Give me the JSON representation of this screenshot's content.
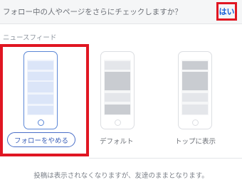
{
  "prompt": {
    "question": "フォロー中の人やページをさらにチェックしますか？",
    "yes_label": "はい"
  },
  "section_label": "ニュースフィード",
  "options": [
    {
      "id": "unfollow",
      "label": "フォローをやめる",
      "selected": true
    },
    {
      "id": "default",
      "label": "デフォルト",
      "selected": false
    },
    {
      "id": "top",
      "label": "トップに表示",
      "selected": false
    }
  ],
  "footer_text": "投稿は表示されなくなりますが、友達のままとなります。",
  "colors": {
    "highlight": "#e01622",
    "accent": "#1760d7",
    "selected_outline": "#5b87d6"
  }
}
